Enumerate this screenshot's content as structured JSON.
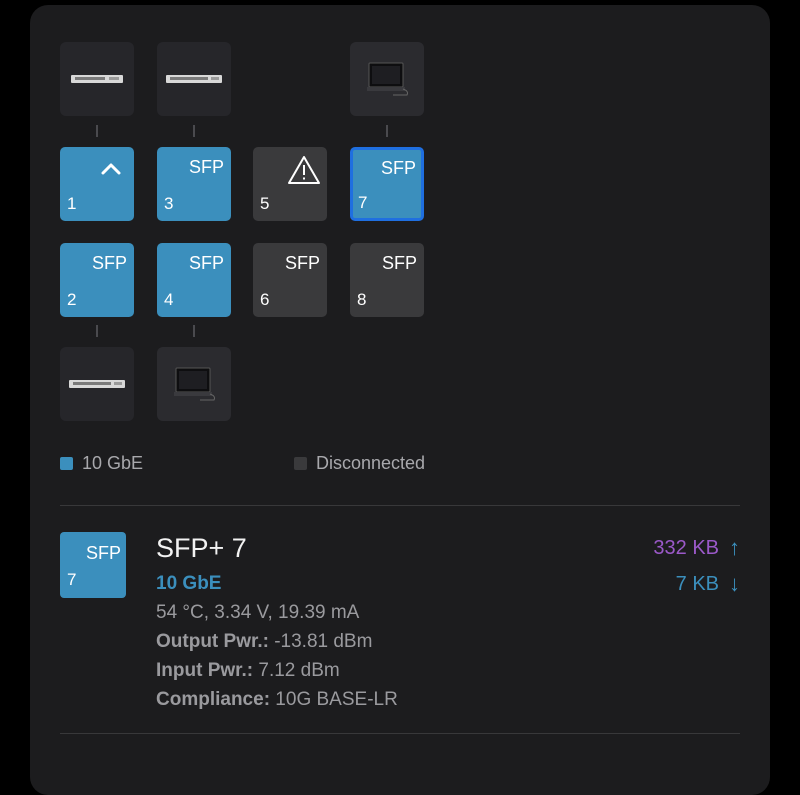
{
  "colors": {
    "up": "#3b8fbd",
    "down": "#3a3a3c",
    "selected_border": "#1f6fe0",
    "tx": "#9b59c9",
    "rx": "#3b8fbd"
  },
  "devices": [
    {
      "id": "dev-top-1",
      "icon": "switch-icon"
    },
    {
      "id": "dev-top-3",
      "icon": "switch-icon"
    },
    {
      "id": "dev-top-7",
      "icon": "monitor-icon"
    },
    {
      "id": "dev-bottom-2",
      "icon": "switch-icon"
    },
    {
      "id": "dev-bottom-4",
      "icon": "monitor-icon"
    }
  ],
  "ports": [
    {
      "num": "1",
      "label": "",
      "state": "up",
      "icon": "chevron-up-icon"
    },
    {
      "num": "3",
      "label": "SFP",
      "state": "up"
    },
    {
      "num": "5",
      "label": "",
      "state": "down",
      "icon": "warning-icon"
    },
    {
      "num": "7",
      "label": "SFP",
      "state": "selected"
    },
    {
      "num": "2",
      "label": "SFP",
      "state": "up"
    },
    {
      "num": "4",
      "label": "SFP",
      "state": "up"
    },
    {
      "num": "6",
      "label": "SFP",
      "state": "down"
    },
    {
      "num": "8",
      "label": "SFP",
      "state": "down"
    }
  ],
  "legend": {
    "connected": "10 GbE",
    "disconnected": "Disconnected"
  },
  "detail": {
    "tile_label": "SFP",
    "tile_num": "7",
    "title": "SFP+ 7",
    "speed": "10 GbE",
    "stats": "54 °C, 3.34 V, 19.39 mA",
    "output_label": "Output Pwr.:",
    "output_value": " -13.81 dBm",
    "input_label": "Input Pwr.:",
    "input_value": " 7.12 dBm",
    "compliance_label": "Compliance:",
    "compliance_value": " 10G BASE-LR",
    "tx_rate": "332 KB",
    "rx_rate": "7 KB",
    "tx_arrow": "↑",
    "rx_arrow": "↓"
  }
}
